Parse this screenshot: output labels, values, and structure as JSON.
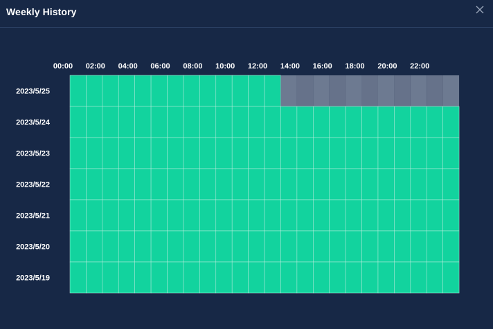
{
  "window": {
    "title": "Weekly History",
    "close_icon": "close-icon"
  },
  "colors": {
    "background": "#172846",
    "available": "#12d39e",
    "unavailable": "#66728a",
    "gridline": "#bfeee0"
  },
  "chart_data": {
    "type": "heatmap",
    "title": "",
    "xlabel": "",
    "ylabel": "",
    "x_tick_labels": [
      "00:00",
      "02:00",
      "04:00",
      "06:00",
      "08:00",
      "10:00",
      "12:00",
      "14:00",
      "16:00",
      "18:00",
      "20:00",
      "22:00"
    ],
    "slots_per_day": 24,
    "rows": [
      {
        "date": "2023/5/25",
        "filled_slots": 13
      },
      {
        "date": "2023/5/24",
        "filled_slots": 24
      },
      {
        "date": "2023/5/23",
        "filled_slots": 24
      },
      {
        "date": "2023/5/22",
        "filled_slots": 24
      },
      {
        "date": "2023/5/21",
        "filled_slots": 24
      },
      {
        "date": "2023/5/20",
        "filled_slots": 24
      },
      {
        "date": "2023/5/19",
        "filled_slots": 24
      }
    ]
  }
}
